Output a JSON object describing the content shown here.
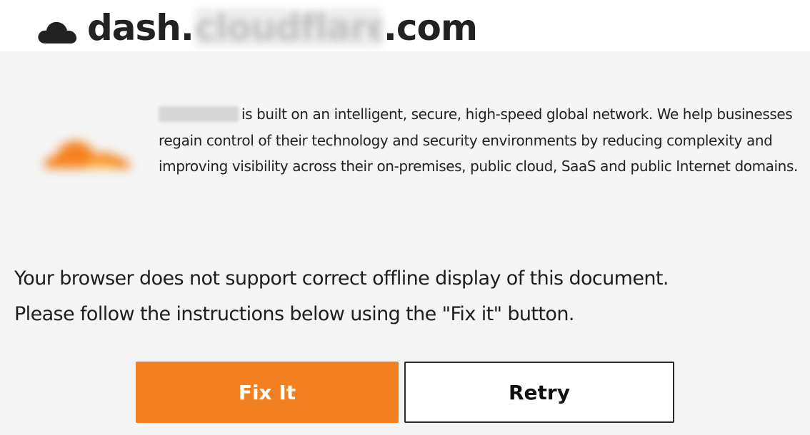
{
  "header": {
    "icon": "cloud-icon",
    "domain_prefix": "dash.",
    "domain_blurred": "cloudflare",
    "domain_suffix": ".com"
  },
  "intro": {
    "logo": "cloudflare-logo",
    "company_blurred": "Cloudflare",
    "text": "is built on an intelligent, secure, high-speed global network. We help businesses regain control of their technology and security environments by reducing complexity and improving visibility across their on-premises, public cloud, SaaS and public Internet domains."
  },
  "message": {
    "line1": "Your browser does not support correct offline display of this document.",
    "line2": "Please follow the instructions below using the \"Fix it\" button."
  },
  "buttons": {
    "fix_label": "Fix It",
    "retry_label": "Retry"
  },
  "colors": {
    "accent": "#f38020",
    "background": "#f4f4f4",
    "header_bg": "#ffffff",
    "text": "#222222"
  }
}
